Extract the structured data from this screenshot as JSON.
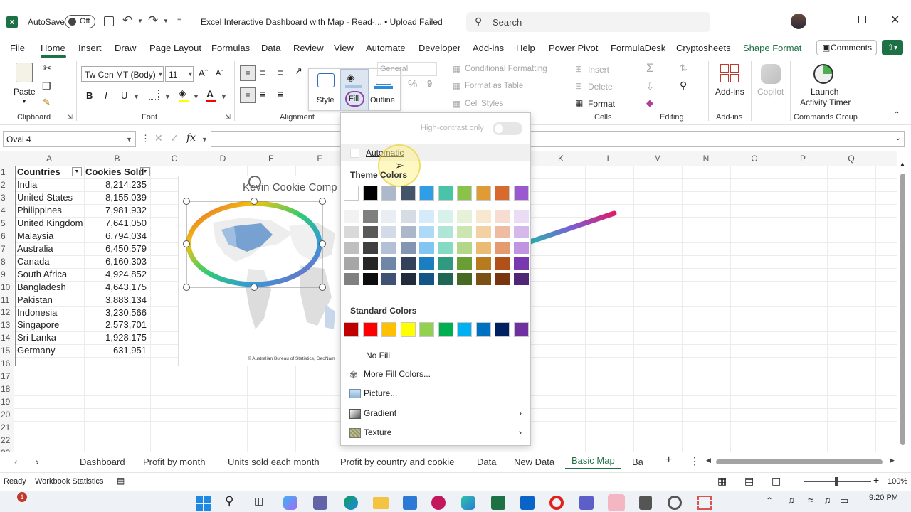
{
  "titlebar": {
    "autosave_label": "AutoSave",
    "autosave_state": "Off",
    "doc_title": "Excel Interactive Dashboard with Map  -  Read-...  • Upload Failed",
    "search_placeholder": "Search"
  },
  "menu": {
    "items": [
      "File",
      "Home",
      "Insert",
      "Draw",
      "Page Layout",
      "Formulas",
      "Data",
      "Review",
      "View",
      "Automate",
      "Developer",
      "Add-ins",
      "Help",
      "Power Pivot",
      "FormulaDesk",
      "Cryptosheets",
      "Shape Format"
    ],
    "active": "Home",
    "comments_label": "Comments"
  },
  "ribbon": {
    "paste_label": "Paste",
    "clipboard_label": "Clipboard",
    "font_name": "Tw Cen MT (Body)",
    "font_size": "11",
    "font_label": "Font",
    "bold": "B",
    "italic": "I",
    "underline": "U",
    "alignment_label": "Alignment",
    "style_label": "Style",
    "fill_label": "Fill",
    "outline_label": "Outline",
    "number_format": "General",
    "percent": "%",
    "comma": "9",
    "cond_format": "Conditional Formatting",
    "format_table": "Format as Table",
    "cell_styles": "Cell Styles",
    "insert_label": "Insert",
    "delete_label": "Delete",
    "format_label": "Format",
    "cells_label": "Cells",
    "sum_symbol": "Σ",
    "editing_label": "Editing",
    "addins_label": "Add-ins",
    "addins_group": "Add-ins",
    "copilot_label": "Copilot",
    "launch_label": "Launch",
    "activity_timer_label": "Activity Timer",
    "commands_group": "Commands Group"
  },
  "formula_bar": {
    "name_box": "Oval 4",
    "fx": "fx"
  },
  "columns": [
    "A",
    "B",
    "C",
    "D",
    "E",
    "F",
    "",
    "",
    "",
    "K",
    "L",
    "M",
    "N",
    "O",
    "P",
    "Q"
  ],
  "rows": [
    "1",
    "2",
    "3",
    "4",
    "5",
    "6",
    "7",
    "8",
    "9",
    "10",
    "11",
    "12",
    "13",
    "14",
    "15",
    "16",
    "17",
    "18",
    "19",
    "20",
    "21",
    "22",
    "23"
  ],
  "table": {
    "header_country": "Countries",
    "header_sold": "Cookies Sold",
    "data": [
      [
        "India",
        "8,214,235"
      ],
      [
        "United States",
        "8,155,039"
      ],
      [
        "Philippines",
        "7,981,932"
      ],
      [
        "United Kingdom",
        "7,641,050"
      ],
      [
        "Malaysia",
        "6,794,034"
      ],
      [
        "Australia",
        "6,450,579"
      ],
      [
        "Canada",
        "6,160,303"
      ],
      [
        "South Africa",
        "4,924,852"
      ],
      [
        "Bangladesh",
        "4,643,175"
      ],
      [
        "Pakistan",
        "3,883,134"
      ],
      [
        "Indonesia",
        "3,230,566"
      ],
      [
        "Singapore",
        "2,573,701"
      ],
      [
        "Sri Lanka",
        "1,928,175"
      ],
      [
        "Germany",
        "631,951"
      ]
    ]
  },
  "chart": {
    "title": "Kevin Cookie Comp",
    "credit": "© Australian Bureau of Statistics, GeoNam"
  },
  "fill_menu": {
    "high_contrast": "High-contrast only",
    "automatic": "Automatic",
    "theme_colors_label": "Theme Colors",
    "standard_colors_label": "Standard Colors",
    "no_fill": "No Fill",
    "more_fill": "More Fill Colors...",
    "picture": "Picture...",
    "gradient": "Gradient",
    "texture": "Texture",
    "theme_top": [
      "#ffffff",
      "#000000",
      "#adb9ca",
      "#44546a",
      "#2e9fe6",
      "#4ac4a6",
      "#8bc34a",
      "#e09b35",
      "#d86a2e",
      "#9b59d0"
    ],
    "theme_shades": [
      [
        "#f2f2f2",
        "#7f7f7f",
        "#e9edf4",
        "#d5dce4",
        "#d6ebfa",
        "#d7f2eb",
        "#e6f2d7",
        "#f8e8d0",
        "#f6ddcf",
        "#eadcf5"
      ],
      [
        "#d9d9d9",
        "#595959",
        "#d4dbe8",
        "#acb8ca",
        "#addaf6",
        "#afe6d8",
        "#cde5b0",
        "#f2d2a2",
        "#eebca0",
        "#d5b9eb"
      ],
      [
        "#bfbfbf",
        "#404040",
        "#b3c0d6",
        "#8395b0",
        "#82c5f2",
        "#86d9c3",
        "#b2d788",
        "#ebbb73",
        "#e59a6f",
        "#bf95e1"
      ],
      [
        "#a6a6a6",
        "#262626",
        "#6e86a8",
        "#33415a",
        "#1c7ec1",
        "#2f9a7f",
        "#6a9e34",
        "#b87a1f",
        "#b25019",
        "#7a38b0"
      ],
      [
        "#808080",
        "#0d0d0d",
        "#3f5273",
        "#222b3c",
        "#135586",
        "#1f6655",
        "#466a22",
        "#7b5115",
        "#773510",
        "#512576"
      ]
    ],
    "standard": [
      "#c00000",
      "#ff0000",
      "#ffc000",
      "#ffff00",
      "#92d050",
      "#00b050",
      "#00b0f0",
      "#0070c0",
      "#002060",
      "#7030a0"
    ]
  },
  "sheet_tabs": [
    "Dashboard",
    "Profit by month",
    "Units sold each month",
    "Profit by country and cookie",
    "Data",
    "New Data",
    "Basic Map",
    "Ba"
  ],
  "active_tab": "Basic Map",
  "status": {
    "ready": "Ready",
    "workbook_stats": "Workbook Statistics",
    "zoom": "100%"
  },
  "taskbar": {
    "time": "9:20 PM"
  },
  "colors": {
    "excel_green": "#217346",
    "accent": "#1a7f37",
    "selection": "#a0a0a0"
  }
}
